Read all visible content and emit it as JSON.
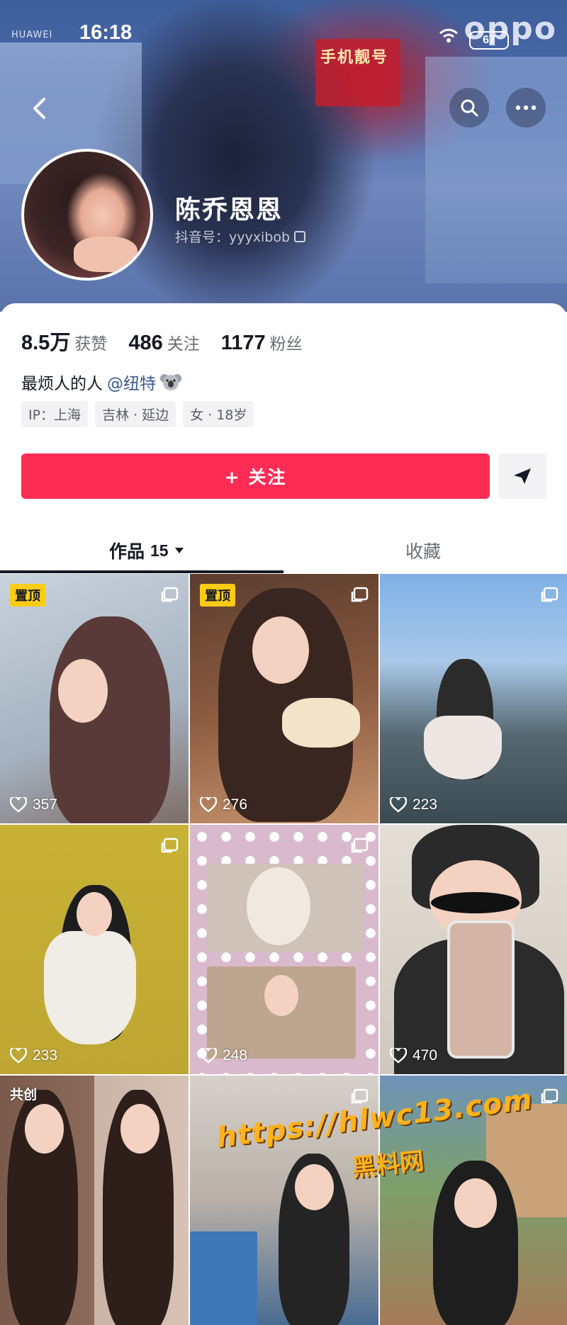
{
  "status_bar": {
    "time": "16:18",
    "battery": "67"
  },
  "banner": {
    "sign_text": "手机靓号",
    "brand_left": "HUAWEI",
    "brand_right": "oppo"
  },
  "profile": {
    "name": "陈乔恩恩",
    "douyin_id_label": "抖音号：yyyxibob"
  },
  "stats": [
    {
      "num": "8.5万",
      "label": "获赞"
    },
    {
      "num": "486",
      "label": "关注"
    },
    {
      "num": "1177",
      "label": "粉丝"
    }
  ],
  "bio": {
    "text": "最烦人的人",
    "mention": "@纽特"
  },
  "tags": [
    "IP：上海",
    "吉林 · 延边",
    "女 · 18岁"
  ],
  "actions": {
    "follow": "+ 关注"
  },
  "tabs": {
    "works_label": "作品",
    "works_count": "15",
    "collect_label": "收藏"
  },
  "posts": [
    {
      "likes": "357",
      "badge": "置顶",
      "colors": [
        "#b7c2cf",
        "#5a3a38"
      ]
    },
    {
      "likes": "276",
      "badge": "置顶",
      "colors": [
        "#6b4a3a",
        "#e8b79a"
      ]
    },
    {
      "likes": "223",
      "badge": "",
      "colors": [
        "#7faee0",
        "#3a4a52"
      ]
    },
    {
      "likes": "233",
      "badge": "",
      "colors": [
        "#c9b43a",
        "#eae6de"
      ]
    },
    {
      "likes": "248",
      "badge": "",
      "colors": [
        "#e8c3d8",
        "#d9b9cc"
      ]
    },
    {
      "likes": "470",
      "badge": "",
      "colors": [
        "#d9d4cc",
        "#3a3a3a"
      ]
    },
    {
      "likes": "",
      "badge": "共创",
      "colors": [
        "#8b6a5a",
        "#f0d8d0"
      ]
    },
    {
      "likes": "",
      "badge": "",
      "colors": [
        "#cfc8c2",
        "#57779a"
      ]
    },
    {
      "likes": "",
      "badge": "",
      "colors": [
        "#6d8fb0",
        "#a47a5a"
      ]
    }
  ],
  "watermark": {
    "url": "https://hlwc13.com",
    "name": "黑料网"
  }
}
